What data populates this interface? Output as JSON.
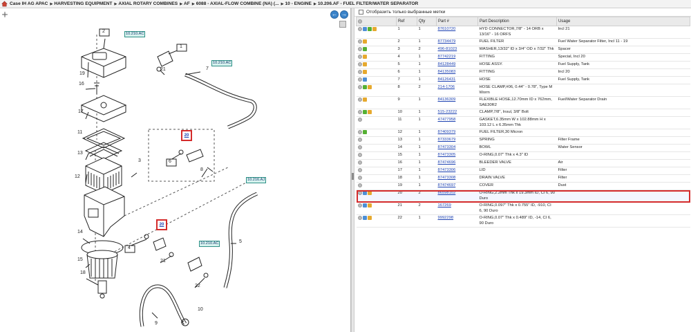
{
  "breadcrumb": [
    "Case IH AG APAC",
    "HARVESTING EQUIPMENT",
    "AXIAL ROTARY COMBINES",
    "AF",
    "6088 - AXIAL-FLOW COMBINE (NA) (...",
    "10 - ENGINE",
    "10.206.AF - FUEL FILTER/WATER SEPARATOR"
  ],
  "diagram": {
    "refs": [
      "10.210.AC",
      "10.210.AC",
      "10.210.AC",
      "10.216.AJ"
    ],
    "highlight_labels": [
      "20",
      "20"
    ],
    "callouts": [
      "1",
      "2",
      "3",
      "4",
      "5",
      "6",
      "7",
      "8",
      "9",
      "10",
      "11",
      "12",
      "13",
      "14",
      "15",
      "16",
      "17",
      "18",
      "19",
      "21",
      "21",
      "22"
    ]
  },
  "filter_label": "Отобразить только выбранные метки",
  "table": {
    "headers": [
      "",
      "Ref",
      "Qty",
      "Part #",
      "Part Description",
      "Usage"
    ],
    "rows": [
      {
        "icons": [
          "gray",
          "blue",
          "green",
          "gold"
        ],
        "ref": "1",
        "qty": "1",
        "part": "87610720",
        "desc": "HYD CONNECTOR,7/8\" - 14 ORB x 13/16\" - 16 ORFS",
        "usage": "Incl 21"
      },
      {
        "icons": [
          "gray",
          "gold"
        ],
        "ref": "2",
        "qty": "1",
        "part": "87734479",
        "desc": "FUEL FILTER",
        "usage": "Fuel Water Separator Filter, Incl 11 - 19"
      },
      {
        "icons": [
          "gray",
          "green"
        ],
        "ref": "3",
        "qty": "2",
        "part": "496-81023",
        "desc": "WASHER,13/32\" ID x 3/4\" OD x 7/32\" Thk",
        "usage": "Spacer"
      },
      {
        "icons": [
          "gray",
          "gold"
        ],
        "ref": "4",
        "qty": "1",
        "part": "87742219",
        "desc": "FITTING",
        "usage": "Special, Incl 20"
      },
      {
        "icons": [
          "gray",
          "gold"
        ],
        "ref": "5",
        "qty": "1",
        "part": "84128449",
        "desc": "HOSE ASSY.",
        "usage": "Fuel Supply, Tank"
      },
      {
        "icons": [
          "gray",
          "gold"
        ],
        "ref": "6",
        "qty": "1",
        "part": "84135083",
        "desc": "FITTING",
        "usage": "Incl 20"
      },
      {
        "icons": [
          "gray",
          "blue"
        ],
        "ref": "7",
        "qty": "1",
        "part": "84126431",
        "desc": "HOSE",
        "usage": "Fuel Supply, Tank"
      },
      {
        "icons": [
          "gray",
          "green",
          "gold"
        ],
        "ref": "8",
        "qty": "2",
        "part": "214-1706",
        "desc": "HOSE CLAMP,#06, 0.44\" - 0.78\", Type M Worm",
        "usage": ""
      },
      {
        "icons": [
          "gray",
          "gold"
        ],
        "ref": "9",
        "qty": "1",
        "part": "84136309",
        "desc": "FLEXIBLE HOSE,12.70mm ID x 762mm, SAE30R2",
        "usage": "Fuel/Water Separator Drain"
      },
      {
        "icons": [
          "gray",
          "green",
          "gold"
        ],
        "ref": "10",
        "qty": "1",
        "part": "515-23222",
        "desc": "CLAMP,7/8\", Insul, 3/8\" Bolt",
        "usage": ""
      },
      {
        "icons": [
          "gray"
        ],
        "ref": "11",
        "qty": "1",
        "part": "47477958",
        "desc": "GASKET,6.35mm W x 102.88mm H x 103.12 L x 6.35mm Thk",
        "usage": ""
      },
      {
        "icons": [
          "gray",
          "green"
        ],
        "ref": "12",
        "qty": "1",
        "part": "87409379",
        "desc": "FUEL FILTER,30 Micron",
        "usage": ""
      },
      {
        "icons": [
          "gray"
        ],
        "ref": "13",
        "qty": "1",
        "part": "87333679",
        "desc": "SPRING",
        "usage": "Filter Frame"
      },
      {
        "icons": [
          "gray"
        ],
        "ref": "14",
        "qty": "1",
        "part": "87473304",
        "desc": "BOWL",
        "usage": "Water Sensor"
      },
      {
        "icons": [
          "gray"
        ],
        "ref": "15",
        "qty": "1",
        "part": "87473305",
        "desc": "O-RING,0.07\" Thk x 4.3\" ID",
        "usage": ""
      },
      {
        "icons": [
          "gray"
        ],
        "ref": "16",
        "qty": "1",
        "part": "87474696",
        "desc": "BLEEDER VALVE",
        "usage": "Air"
      },
      {
        "icons": [
          "gray"
        ],
        "ref": "17",
        "qty": "1",
        "part": "87473306",
        "desc": "LID",
        "usage": "Filter"
      },
      {
        "icons": [
          "gray"
        ],
        "ref": "18",
        "qty": "1",
        "part": "87473308",
        "desc": "DRAIN VALVE",
        "usage": "Filter"
      },
      {
        "icons": [
          "gray"
        ],
        "ref": "19",
        "qty": "1",
        "part": "87474697",
        "desc": "COVER",
        "usage": "Dust"
      },
      {
        "icons": [
          "gray",
          "blue",
          "gold"
        ],
        "ref": "20",
        "qty": "2",
        "part": "86598102",
        "desc": "O-RING,2.2mm Thk x 19.3mm ID, CI 6, 90 Duro",
        "usage": "",
        "selected": true
      },
      {
        "icons": [
          "gray",
          "blue",
          "gold"
        ],
        "ref": "21",
        "qty": "2",
        "part": "167269",
        "desc": "O-RING,0.097\" Thk x 0.755\" ID, -910, CI 6, 90 Duro",
        "usage": ""
      },
      {
        "icons": [
          "gray",
          "blue",
          "gold"
        ],
        "ref": "22",
        "qty": "1",
        "part": "9992298",
        "desc": "O-RING,0.07\" Thk x 0.489\" ID, -14, CI 6, 90 Duro",
        "usage": ""
      }
    ]
  }
}
